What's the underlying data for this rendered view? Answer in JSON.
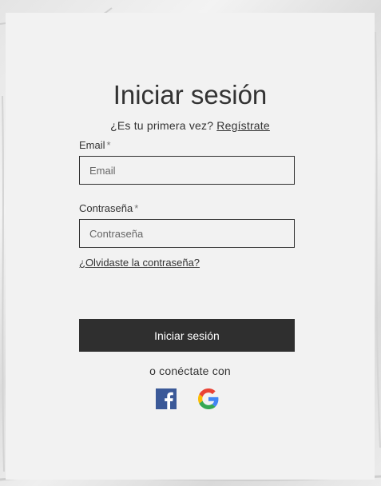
{
  "login": {
    "title": "Iniciar sesión",
    "signup_prompt": "¿Es tu primera vez?",
    "signup_link": "Regístrate",
    "email": {
      "label": "Email",
      "required_mark": "*",
      "placeholder": "Email",
      "value": ""
    },
    "password": {
      "label": "Contraseña",
      "required_mark": "*",
      "placeholder": "Contraseña",
      "value": ""
    },
    "forgot_link": "¿Olvidaste la contraseña?",
    "submit_label": "Iniciar sesión",
    "connect_text": "o conéctate con",
    "social": [
      {
        "icon": "facebook-icon",
        "color": "#3b5998"
      },
      {
        "icon": "google-icon",
        "colors": [
          "#4285F4",
          "#EA4335",
          "#FBBC05",
          "#34A853"
        ]
      }
    ]
  },
  "colors": {
    "card_background": "#f2f2f2",
    "button_background": "#2f2f2f",
    "button_text": "#ffffff",
    "text": "#333333"
  }
}
